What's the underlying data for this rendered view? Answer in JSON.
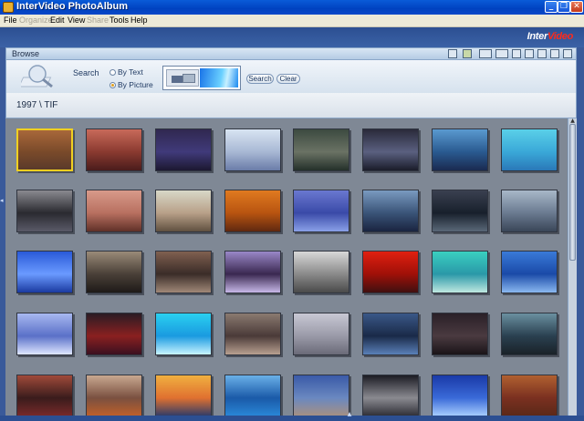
{
  "window": {
    "title": "InterVideo PhotoAlbum",
    "minimize_glyph": "_",
    "restore_glyph": "❐",
    "close_glyph": "✕"
  },
  "menu": {
    "items": [
      {
        "label": "File",
        "enabled": true
      },
      {
        "label": "Organize",
        "enabled": false
      },
      {
        "label": "Edit",
        "enabled": true
      },
      {
        "label": "View",
        "enabled": true
      },
      {
        "label": "Share",
        "enabled": false
      },
      {
        "label": "Tools",
        "enabled": true
      },
      {
        "label": "Help",
        "enabled": true
      }
    ]
  },
  "brand": {
    "part1": "Inter",
    "part2": "Video"
  },
  "browse": {
    "label": "Browse",
    "toolbar_icons": [
      "edit-icon",
      "people-icon",
      "view-list-icon",
      "dropdown-icon",
      "slideshow-icon",
      "checklist-icon",
      "trash-icon",
      "sort-icon",
      "zoom-icon"
    ]
  },
  "search": {
    "label": "Search",
    "options": [
      {
        "label": "By Text",
        "selected": false
      },
      {
        "label": "By Picture",
        "selected": true
      }
    ],
    "search_button": "Search",
    "clear_button": "Clear"
  },
  "path": {
    "text": "1997 \\ TIF"
  },
  "thumbnails": {
    "columns": 8,
    "selected_index": 0,
    "items": [
      [
        "#a8683a",
        "#7a4a2a",
        "#5a3a2a"
      ],
      [
        "#c86a5a",
        "#8a3a30",
        "#4a1c1c"
      ],
      [
        "#302850",
        "#403a7a",
        "#1c1830"
      ],
      [
        "#d8e4f2",
        "#a8b8d4",
        "#6a7ca8"
      ],
      [
        "#3c4a40",
        "#6a7264",
        "#24302a"
      ],
      [
        "#2a2a3a",
        "#5a6080",
        "#1a1c2a"
      ],
      [
        "#5a9ad0",
        "#2a5a90",
        "#1a2a50"
      ],
      [
        "#5ad0e8",
        "#3aa8d8",
        "#2a78b8"
      ],
      [
        "#8a8a90",
        "#2a2a30",
        "#5a5a68"
      ],
      [
        "#d89a8a",
        "#b87060",
        "#603028"
      ],
      [
        "#d8d8c8",
        "#b8a088",
        "#605040"
      ],
      [
        "#e07a20",
        "#b85410",
        "#602810"
      ],
      [
        "#6a78d0",
        "#3a4aa8",
        "#8aa0e8"
      ],
      [
        "#7a9ac0",
        "#3a5478",
        "#1a2440"
      ],
      [
        "#3a4050",
        "#18202c",
        "#5a6878"
      ],
      [
        "#a8b8c8",
        "#6a7a90",
        "#3a4658"
      ],
      [
        "#2a5ad8",
        "#6a9aff",
        "#1a3aa0"
      ],
      [
        "#9a8a78",
        "#4a4038",
        "#1e1a18"
      ],
      [
        "#806050",
        "#3a2c28",
        "#a08878"
      ],
      [
        "#9a88c8",
        "#3a2850",
        "#c8b8e8"
      ],
      [
        "#d8d8d8",
        "#8a8a8a",
        "#4a4a4a"
      ],
      [
        "#e02010",
        "#a01008",
        "#401010"
      ],
      [
        "#3ad0c0",
        "#2a98a8",
        "#bfe8e0"
      ],
      [
        "#3a7ad8",
        "#1a4aa8",
        "#8ab8f0"
      ],
      [
        "#a8b8f0",
        "#5a70c8",
        "#dfe6ff"
      ],
      [
        "#2a1c24",
        "#8a2020",
        "#3a1020"
      ],
      [
        "#2ad0f0",
        "#1a9ae0",
        "#c8f4ff"
      ],
      [
        "#8a7a70",
        "#4a3a38",
        "#b8a090"
      ],
      [
        "#c8c8d4",
        "#9a9aa8",
        "#6a6a78"
      ],
      [
        "#3a5888",
        "#1a2a48",
        "#5a80b8"
      ],
      [
        "#2a2028",
        "#4a3a40",
        "#1a1418"
      ],
      [
        "#6a90a0",
        "#2a4050",
        "#1a2228"
      ],
      [
        "#a04a3a",
        "#3a1c1c",
        "#7a2a2a"
      ],
      [
        "#c8a890",
        "#7a5040",
        "#c0602a"
      ],
      [
        "#f0b040",
        "#e07030",
        "#2a3a6a"
      ],
      [
        "#6ab0e8",
        "#1a5aa8",
        "#2a88d8"
      ],
      [
        "#3a5aa8",
        "#6a88c0",
        "#a89080"
      ],
      [
        "#1c1c24",
        "#8a8a90",
        "#2c2c34"
      ],
      [
        "#1a3aa8",
        "#3a6ad8",
        "#aad0ff"
      ],
      [
        "#b06030",
        "#7a3020",
        "#5a2818"
      ]
    ]
  }
}
